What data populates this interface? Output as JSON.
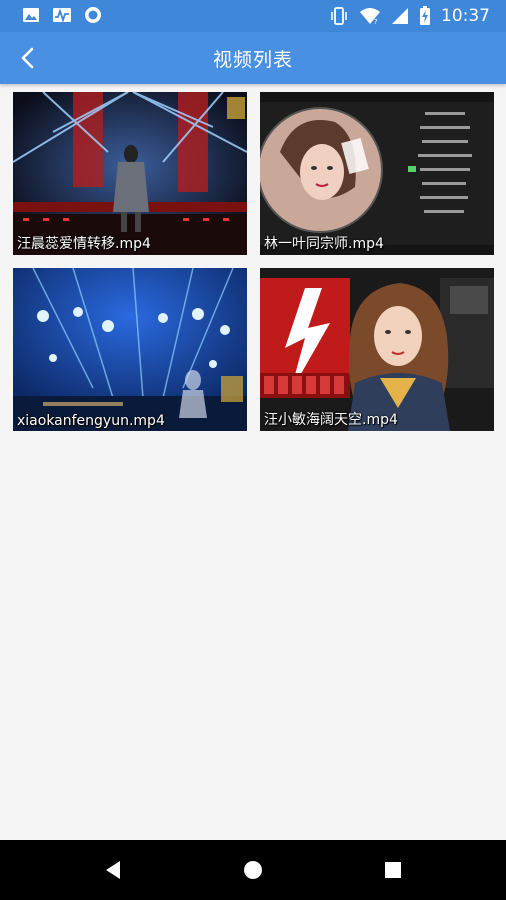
{
  "status_bar": {
    "time": "10:37",
    "left_icons": [
      "image-icon",
      "activity-icon",
      "circle-icon"
    ],
    "right_icons": [
      "vibrate-icon",
      "wifi-icon",
      "signal-icon",
      "battery-icon"
    ]
  },
  "app_bar": {
    "title": "视频列表",
    "back_icon": "back-arrow-icon"
  },
  "videos": [
    {
      "file_name": "汪晨蕊爱情转移.mp4"
    },
    {
      "file_name": "林一叶同宗师.mp4"
    },
    {
      "file_name": "xiaokanfengyun.mp4"
    },
    {
      "file_name": "汪小敏海阔天空.mp4"
    }
  ],
  "nav_bar": {
    "icons": [
      "back-triangle-icon",
      "home-circle-icon",
      "recents-square-icon"
    ]
  },
  "colors": {
    "status_bar": "#3f87d8",
    "app_bar": "#4a90e2",
    "background": "#f5f5f5",
    "nav_bar": "#000000"
  }
}
